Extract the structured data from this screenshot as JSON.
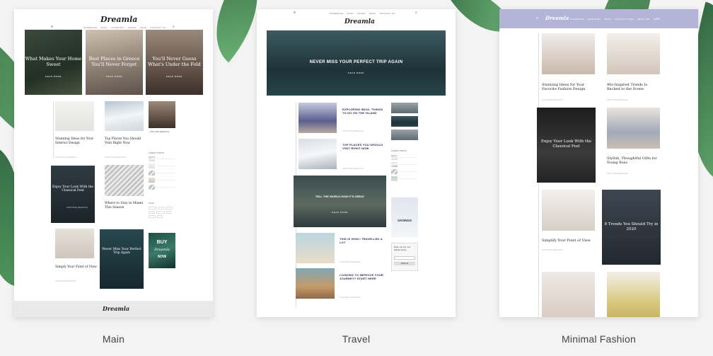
{
  "colors": {
    "page_bg": "#f3f3f3",
    "fashion_header": "#b4b4d8",
    "leaf": "#2d6a3a"
  },
  "demos": [
    {
      "label": "Main"
    },
    {
      "label": "Travel"
    },
    {
      "label": "Minimal Fashion"
    }
  ],
  "main": {
    "logo": "Dreamla",
    "footer_logo": "Dreamla",
    "nav": [
      "HOMEPAGE",
      "BLOG",
      "CATEGORY",
      "PAGES",
      "SHOP",
      "CONTACT US"
    ],
    "hero_slides": [
      {
        "title": "What Makes Your Home Sweet",
        "button": "READ MORE"
      },
      {
        "title": "Best Places in Greece You'll Never Forget",
        "button": "READ MORE"
      },
      {
        "title": "You'll Never Guess What's Under the Fold",
        "button": "READ MORE"
      }
    ],
    "posts": [
      {
        "title": "Stunning Ideas for Your Interior Design",
        "more": "CONTINUE READING"
      },
      {
        "title": "Top Places You Should Visit Right Now",
        "more": "CONTINUE READING"
      },
      {
        "title": "Enjoy Your Look With the Classical Feel",
        "more": "CONTINUE READING"
      },
      {
        "title": "Where to Stay in Miami This Season",
        "more": "CONTINUE READING"
      },
      {
        "title": "Simply Your Point of View",
        "more": "CONTINUE READING"
      },
      {
        "title": "Never Miss Your Perfect Trip Again",
        "more": "CONTINUE READING"
      }
    ],
    "sidebar": {
      "author": "FOLLOW DREAMLA",
      "latest_heading": "LATEST POSTS",
      "tags_heading": "TAGS",
      "ad": {
        "text": "BUY",
        "logo": "Dreamla",
        "sub": "NOW"
      }
    }
  },
  "travel": {
    "logo": "Dreamla",
    "nav": [
      "HOMEPAGE",
      "BLOG",
      "PAGES",
      "SHOP",
      "CONTACT US"
    ],
    "hero": {
      "title": "NEVER MISS YOUR PERFECT TRIP AGAIN",
      "button": "READ MORE"
    },
    "posts": [
      {
        "title": "EXPLORING IBIZA: THINGS TO DO ON THE ISLAND",
        "more": "CONTINUE READING"
      },
      {
        "title": "TOP PLACES YOU SHOULD VISIT RIGHT NOW",
        "more": "CONTINUE READING"
      },
      {
        "title": "TELL THE WORLD HOW IT'S GREAT",
        "more": "READ MORE"
      },
      {
        "title": "THIS IS HOW I TRAVELLED A LOT",
        "more": "CONTINUE READING"
      },
      {
        "title": "LOOKING TO IMPROVE YOUR JOURNEY? START HERE",
        "more": "CONTINUE READING"
      }
    ],
    "sidebar": {
      "latest_heading": "LATEST POSTS",
      "banner": "SAVINGS",
      "newsletter": "Sign up for our latest news",
      "newsletter_button": "SIGN UP"
    }
  },
  "fashion": {
    "logo": "Dreamla",
    "nav": [
      "HOMEPAGE",
      "CATEGORY",
      "BLOG",
      "CONTACT PAGE",
      "ABOUT ME",
      "SHOP"
    ],
    "posts": [
      {
        "title": "Stunning Ideas for Your Favorite Fashion Design",
        "more": "CONTINUE READING"
      },
      {
        "title": "90s-Inspired Trends Is Backed to the Scene",
        "more": "CONTINUE READING"
      },
      {
        "title": "Enjoy Your Look With the Classical Feel",
        "more": "CONTINUE READING"
      },
      {
        "title": "Stylish, Thoughtful Gifts for Young Boss",
        "more": "CONTINUE READING"
      },
      {
        "title": "Simplify Your Point of View",
        "more": "CONTINUE READING"
      },
      {
        "title": "8 Trends You Should Try in 2020",
        "more": "CONTINUE READING"
      }
    ]
  }
}
